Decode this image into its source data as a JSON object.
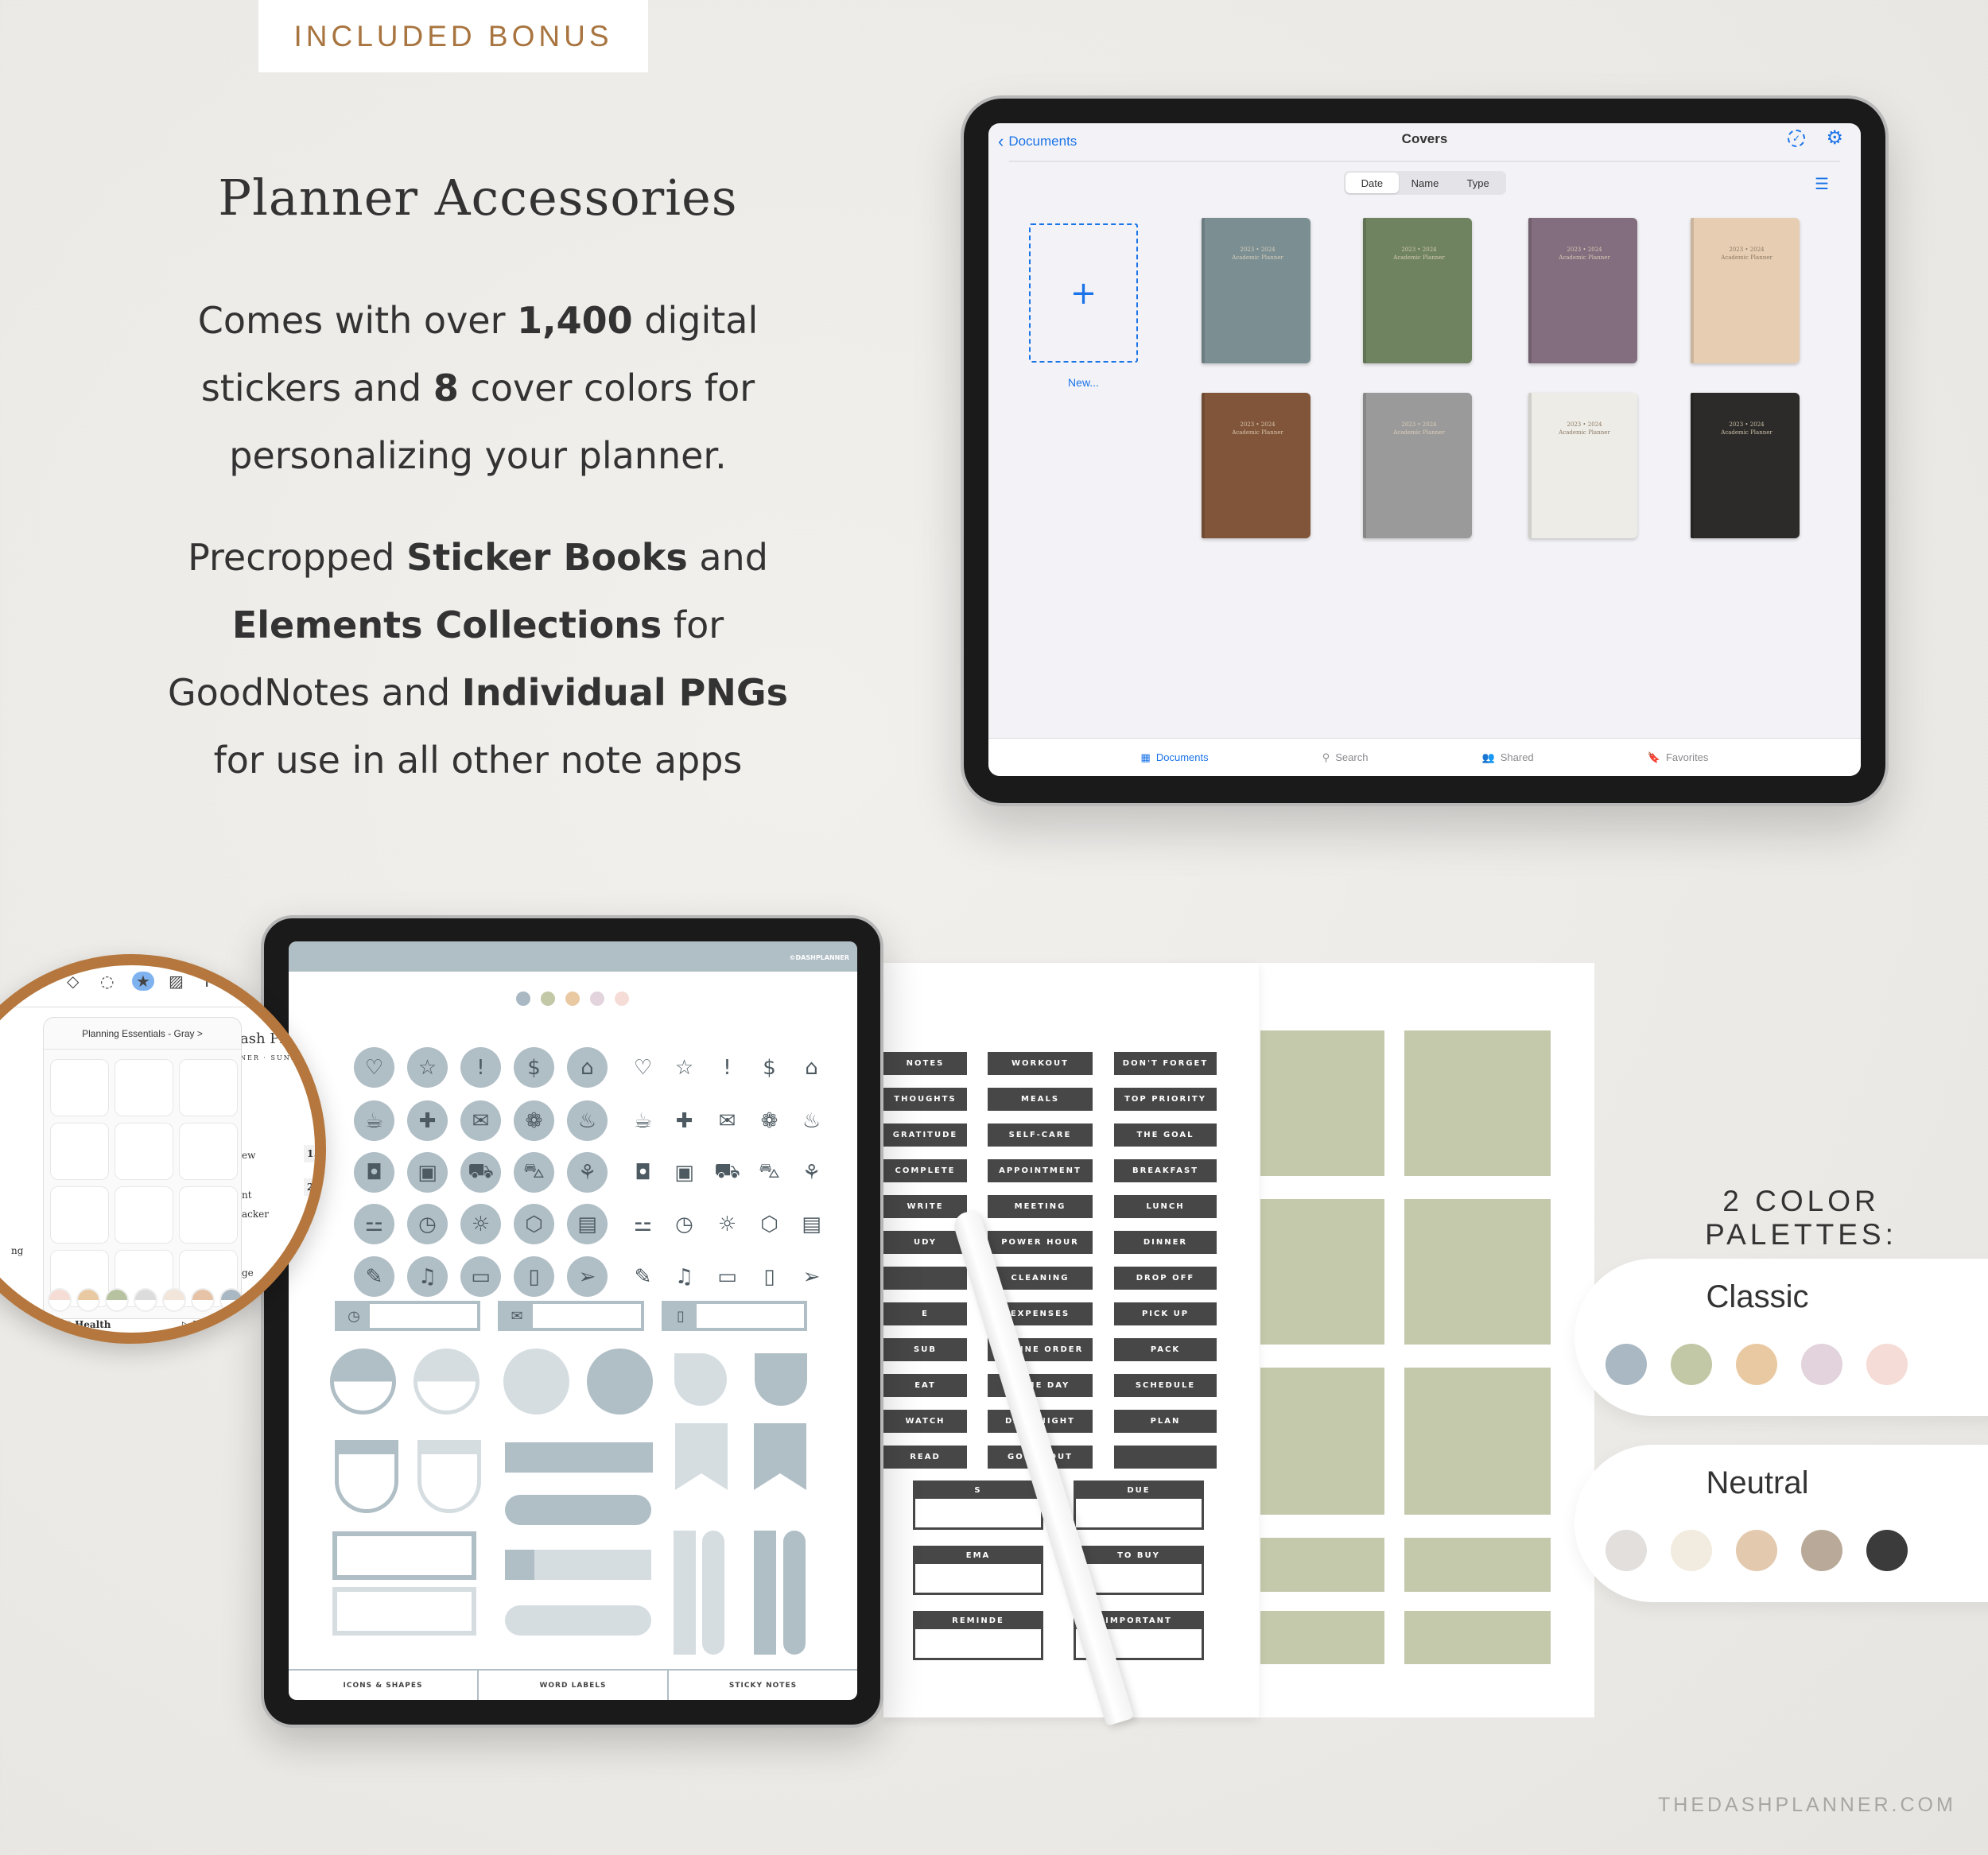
{
  "badge": "INCLUDED BONUS",
  "title": "Planner Accessories",
  "para1": {
    "l1a": "Comes with over ",
    "l1b": "1,400",
    "l1c": " digital",
    "l2a": "stickers and ",
    "l2b": "8",
    "l2c": " cover colors for",
    "l3": "personalizing your planner."
  },
  "para2": {
    "l1a": "Precropped ",
    "l1b": "Sticker Books",
    "l1c": " and",
    "l2b": "Elements Collections",
    "l2c": " for",
    "l3a": "GoodNotes and ",
    "l3b": "Individual PNGs",
    "l4": "for use in all other note apps"
  },
  "top_ipad": {
    "back": "Documents",
    "title": "Covers",
    "sort": [
      "Date",
      "Name",
      "Type"
    ],
    "sort_selected": "Date",
    "new_label": "New...",
    "covers": [
      {
        "color": "#7b8f93",
        "year": "2023 • 2024",
        "name": "Academic Planner"
      },
      {
        "color": "#6f8360",
        "year": "2023 • 2024",
        "name": "Academic Planner"
      },
      {
        "color": "#826e7e",
        "year": "2023 • 2024",
        "name": "Academic Planner"
      },
      {
        "color": "#e7cdb2",
        "year": "2023 • 2024",
        "name": "Academic Planner"
      },
      {
        "color": "#80553a",
        "year": "2023 • 2024",
        "name": "Academic Planner"
      },
      {
        "color": "#9a9a9a",
        "year": "2023 • 2024",
        "name": "Academic Planner"
      },
      {
        "color": "#eeece6",
        "year": "2023 • 2024",
        "name": "Academic Planner"
      },
      {
        "color": "#2c2b29",
        "year": "2023 • 2024",
        "name": "Academic Planner"
      }
    ],
    "tabs": [
      "Documents",
      "Search",
      "Shared",
      "Favorites"
    ],
    "active_tab": "Documents"
  },
  "bottom_ipad": {
    "brand": "©DASHPLANNER",
    "color_dots": [
      "#a9b8c2",
      "#c2c8a6",
      "#e9c9a2",
      "#e2d3dc",
      "#f6dcd6"
    ],
    "icons": [
      "heart",
      "star",
      "exclamation",
      "dollar",
      "home",
      "coffee-cup",
      "plus",
      "envelope",
      "paw",
      "cupcake",
      "backpack",
      "briefcase",
      "car",
      "cart",
      "utensils",
      "dumbbell",
      "clock",
      "lightbulb",
      "box",
      "book",
      "pencil",
      "music",
      "laptop",
      "phone",
      "paper-plane"
    ],
    "tabs": [
      "ICONS & SHAPES",
      "WORD LABELS",
      "STICKY NOTES"
    ]
  },
  "word_labels": [
    [
      "NOTES",
      "THOUGHTS",
      "GRATITUDE",
      "COMPLETE",
      "WRITE",
      "UDY",
      "",
      "E",
      "SUB",
      "EAT",
      "WATCH",
      "READ"
    ],
    [
      "WORKOUT",
      "MEALS",
      "SELF-CARE",
      "APPOINTMENT",
      "MEETING",
      "POWER HOUR",
      "CLEANING",
      "EXPENSES",
      "ONLINE ORDER",
      "GAME DAY",
      "DATE NIGHT",
      "GOING OUT"
    ],
    [
      "DON'T FORGET",
      "TOP PRIORITY",
      "THE GOAL",
      "BREAKFAST",
      "LUNCH",
      "DINNER",
      "DROP OFF",
      "PICK UP",
      "PACK",
      "SCHEDULE",
      "PLAN",
      ""
    ]
  ],
  "sticky_notes": [
    "S",
    "DUE",
    "EMA",
    "TO BUY",
    "REMINDE",
    "IMPORTANT"
  ],
  "magnifier": {
    "popup_title": "Planning Essentials - Gray >",
    "bg_title": "ash Plan",
    "bg_sub": "NER · SUNDAY",
    "bg_items": [
      "ew",
      "nt",
      "acker",
      "ge",
      "ng"
    ],
    "bg_nums": [
      "1.",
      "2."
    ],
    "footer": [
      "Health",
      "Entert"
    ],
    "swatches": [
      "#f5ddd6",
      "#e9c9a2",
      "#b7c3a0",
      "#dcdcdc",
      "#f2e6da",
      "#e6c3a6",
      "#a9b8c2"
    ]
  },
  "palettes": {
    "title": "2 COLOR PALETTES:",
    "classic": {
      "name": "Classic",
      "colors": [
        "#a9b8c2",
        "#c2c8a6",
        "#e9c9a2",
        "#e2d3dc",
        "#f6dcd6"
      ]
    },
    "neutral": {
      "name": "Neutral",
      "colors": [
        "#e2dfdd",
        "#f2ebdf",
        "#e3c9ae",
        "#b9a998",
        "#3b3b3b"
      ]
    }
  },
  "footer": "THEDASHPLANNER.COM"
}
